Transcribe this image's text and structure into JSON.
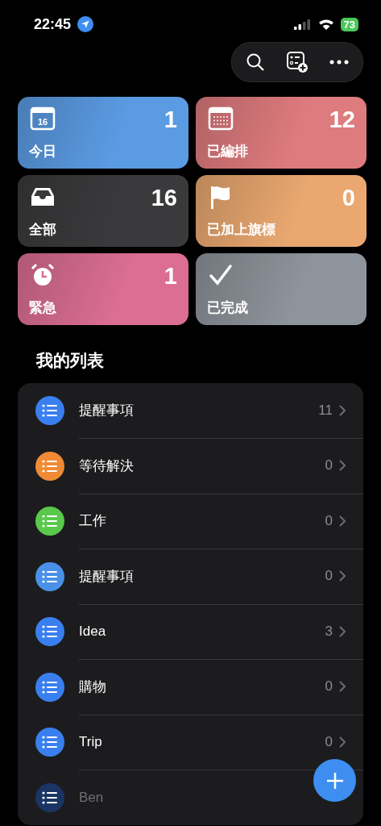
{
  "status_bar": {
    "time": "22:45",
    "battery": "73"
  },
  "toolbar": {
    "buttons": [
      {
        "kind": "search"
      },
      {
        "kind": "add-list"
      },
      {
        "kind": "more"
      }
    ]
  },
  "smart_lists": [
    {
      "kind": "today",
      "label": "今日",
      "count": "1",
      "icon_text": "16",
      "color": "#5b9be3"
    },
    {
      "kind": "scheduled",
      "label": "已編排",
      "count": "12",
      "color": "#de7b7e"
    },
    {
      "kind": "all",
      "label": "全部",
      "count": "16",
      "color": "#3a3a3c"
    },
    {
      "kind": "flagged",
      "label": "已加上旗標",
      "count": "0",
      "color": "#eaa870"
    },
    {
      "kind": "urgent",
      "label": "緊急",
      "count": "1",
      "color": "#db6e92"
    },
    {
      "kind": "completed",
      "label": "已完成",
      "color": "#8e949b"
    }
  ],
  "my_lists": {
    "title": "我的列表",
    "items": [
      {
        "name": "提醒事項",
        "count": "11",
        "color": "#3a7ff0",
        "faded": false
      },
      {
        "name": "等待解決",
        "count": "0",
        "color": "#f08a34",
        "faded": false
      },
      {
        "name": "工作",
        "count": "0",
        "color": "#5ac84b",
        "faded": false
      },
      {
        "name": "提醒事項",
        "count": "0",
        "color": "#4a90e8",
        "faded": false
      },
      {
        "name": "Idea",
        "count": "3",
        "color": "#3a7ff0",
        "faded": false
      },
      {
        "name": "購物",
        "count": "0",
        "color": "#3a7ff0",
        "faded": false
      },
      {
        "name": "Trip",
        "count": "0",
        "color": "#3a7ff0",
        "faded": false
      },
      {
        "name": "Ben",
        "color": "#1a3563",
        "faded": true
      }
    ]
  },
  "fab": {
    "kind": "add"
  }
}
